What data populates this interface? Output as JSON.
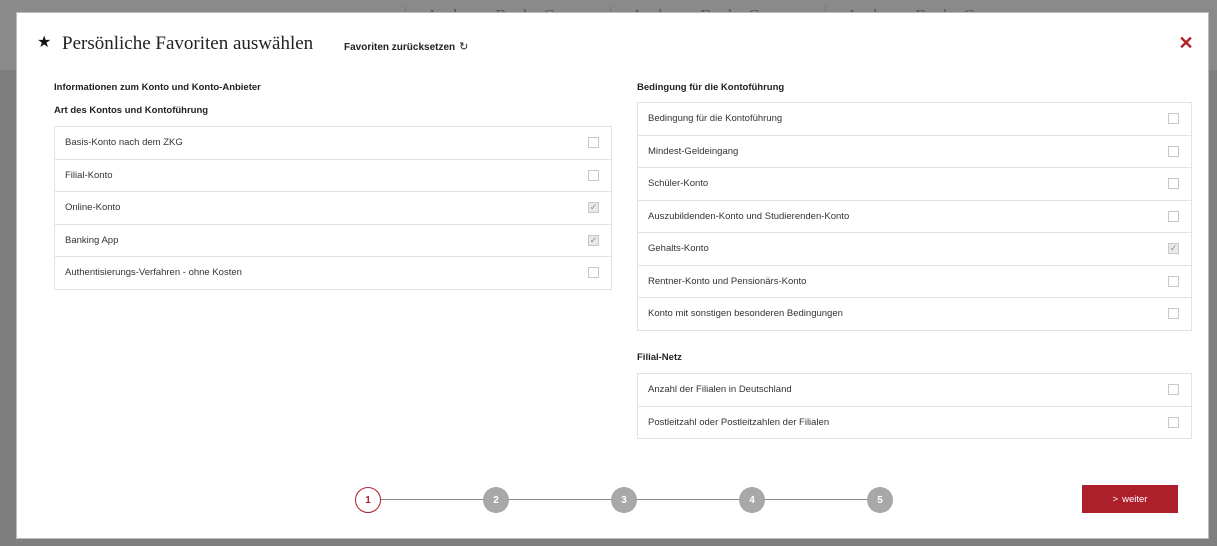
{
  "background": {
    "banks": [
      "Aachener Bank eG",
      "Aachener Bank eG",
      "Aachener Bank eG"
    ]
  },
  "modal": {
    "title": "Persönliche Favoriten auswählen",
    "reset_label": "Favoriten zurücksetzen",
    "reset_icon": "↻",
    "close_icon": "✕",
    "star_icon": "★"
  },
  "left": {
    "section1_title": "Informationen zum Konto und Konto-Anbieter",
    "section2_title": "Art des Kontos und Kontoführung",
    "items": [
      {
        "label": "Basis-Konto nach dem ZKG",
        "checked": false
      },
      {
        "label": "Filial-Konto",
        "checked": false
      },
      {
        "label": "Online-Konto",
        "checked": true
      },
      {
        "label": "Banking App",
        "checked": true
      },
      {
        "label": "Authentisierungs-Verfahren - ohne Kosten",
        "checked": false
      }
    ]
  },
  "right": {
    "section1_title": "Bedingung für die Kontoführung",
    "items1": [
      {
        "label": "Bedingung für die Kontoführung",
        "checked": false
      },
      {
        "label": "Mindest-Geldeingang",
        "checked": false
      },
      {
        "label": "Schüler-Konto",
        "checked": false
      },
      {
        "label": "Auszubildenden-Konto und Studierenden-Konto",
        "checked": false
      },
      {
        "label": "Gehalts-Konto",
        "checked": true
      },
      {
        "label": "Rentner-Konto und Pensionärs-Konto",
        "checked": false
      },
      {
        "label": "Konto mit sonstigen besonderen Bedingungen",
        "checked": false
      }
    ],
    "section2_title": "Filial-Netz",
    "items2": [
      {
        "label": "Anzahl der Filialen in Deutschland",
        "checked": false
      },
      {
        "label": "Postleitzahl oder Postleitzahlen der Filialen",
        "checked": false
      }
    ]
  },
  "steps": {
    "items": [
      "1",
      "2",
      "3",
      "4",
      "5"
    ],
    "active": "1"
  },
  "next_button": {
    "arrow": ">",
    "label": "weiter"
  },
  "colors": {
    "accent": "#ad1f2a",
    "inactive_step": "#a8a8a8",
    "overlay": "#7f7f7f"
  }
}
